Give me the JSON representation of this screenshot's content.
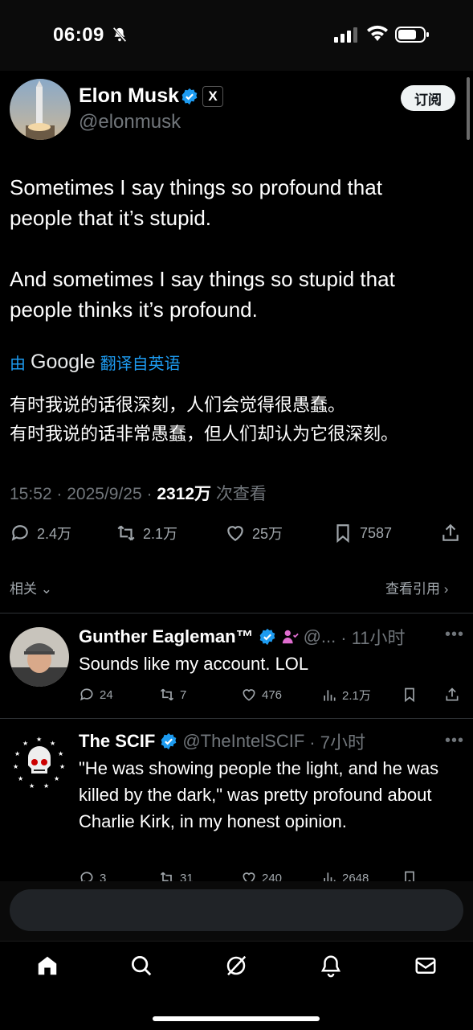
{
  "status_bar": {
    "time": "06:09"
  },
  "tweet": {
    "author_name": "Elon Musk",
    "author_handle": "@elonmusk",
    "badge_x": "X",
    "subscribe_label": "订阅",
    "text": "Sometimes I say things so profound that\npeople that it’s stupid.\n\nAnd sometimes I say things so stupid that\npeople thinks it’s profound.",
    "translate_prefix": "由",
    "translate_brand": "Google",
    "translate_suffix": "翻译自英语",
    "translated_text": "有时我说的话很深刻，人们会觉得很愚蠢。\n有时我说的话非常愚蠢，但人们却认为它很深刻。",
    "time": "15:52",
    "date": "2025/9/25",
    "views": "2312万",
    "views_label": "次查看",
    "replies": "2.4万",
    "reposts": "2.1万",
    "likes": "25万",
    "bookmarks": "7587",
    "related_label": "相关",
    "quotes_label": "查看引用"
  },
  "replies": [
    {
      "name": "Gunther Eagleman™",
      "handle": "@...",
      "time": "· 11小时",
      "text": "Sounds like my account.  LOL",
      "reply_count": "24",
      "repost_count": "7",
      "like_count": "476",
      "view_count": "2.1万"
    },
    {
      "name": "The SCIF",
      "handle": "@TheIntelSCIF",
      "time": "· 7小时",
      "text": "\"He was showing people the light, and he was killed by the dark,\" was pretty profound about Charlie Kirk, in my honest opinion.",
      "reply_count": "3",
      "repost_count": "31",
      "like_count": "240",
      "view_count": "2648"
    }
  ],
  "colors": {
    "accent": "#1d9bf0",
    "background": "#000000",
    "muted": "#71767b"
  },
  "nav": [
    "home-icon",
    "search-icon",
    "grok-icon",
    "notifications-icon",
    "messages-icon"
  ]
}
